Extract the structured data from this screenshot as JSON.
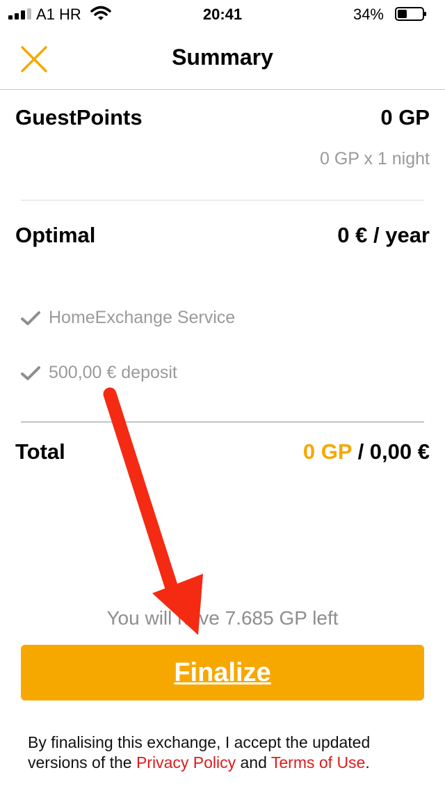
{
  "status_bar": {
    "carrier": "A1 HR",
    "time": "20:41",
    "battery_pct": "34%"
  },
  "header": {
    "title": "Summary",
    "close_icon": "close-icon"
  },
  "guestpoints": {
    "label": "GuestPoints",
    "value": "0 GP",
    "detail": "0 GP x 1 night"
  },
  "plan": {
    "label": "Optimal",
    "value": "0 € / year",
    "features": [
      "HomeExchange Service",
      "500,00 € deposit"
    ]
  },
  "total": {
    "label": "Total",
    "gp": "0 GP",
    "separator": " / ",
    "eur": "0,00 €"
  },
  "remaining_note": "You will have 7.685 GP left",
  "finalize_label": "Finalize",
  "legal": {
    "prefix": "By finalising this exchange, I accept the updated versions of the ",
    "privacy": "Privacy Policy",
    "middle": " and ",
    "terms": "Terms of Use",
    "suffix": "."
  },
  "colors": {
    "accent": "#f7a800",
    "link": "#e01a1a",
    "annotation_arrow": "#f52a12"
  }
}
